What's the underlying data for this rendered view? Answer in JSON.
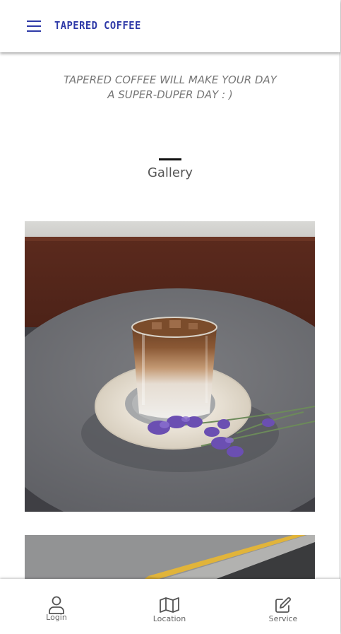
{
  "header": {
    "brand": "TAPERED COFFEE",
    "menu_icon": "hamburger-menu-icon",
    "accent_color": "#2f3aa8"
  },
  "tagline": {
    "line1": "TAPERED COFFEE WILL MAKE YOUR DAY",
    "line2": "A SUPER-DUPER DAY : )"
  },
  "gallery": {
    "title": "Gallery",
    "images": [
      {
        "subject": "iced latte on saucer with lavender"
      },
      {
        "subject": "pavement with yellow tactile strip"
      }
    ]
  },
  "bottom_nav": {
    "items": [
      {
        "label": "Login",
        "icon": "user-icon"
      },
      {
        "label": "Location",
        "icon": "map-icon"
      },
      {
        "label": "Service",
        "icon": "edit-icon"
      }
    ]
  }
}
